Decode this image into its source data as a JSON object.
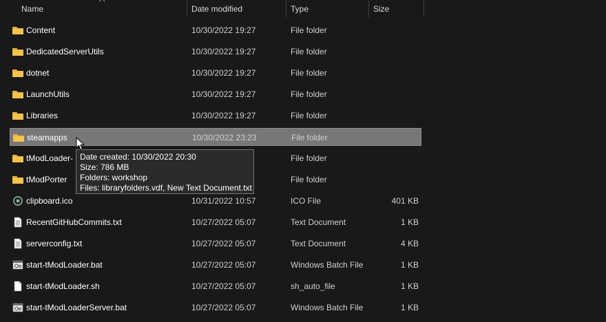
{
  "columns": {
    "name": "Name",
    "date": "Date modified",
    "type": "Type",
    "size": "Size"
  },
  "files": [
    {
      "name": "Content",
      "date": "10/30/2022 19:27",
      "type": "File folder",
      "size": "",
      "icon": "folder-icon"
    },
    {
      "name": "DedicatedServerUtils",
      "date": "10/30/2022 19:27",
      "type": "File folder",
      "size": "",
      "icon": "folder-icon"
    },
    {
      "name": "dotnet",
      "date": "10/30/2022 19:27",
      "type": "File folder",
      "size": "",
      "icon": "folder-icon"
    },
    {
      "name": "LaunchUtils",
      "date": "10/30/2022 19:27",
      "type": "File folder",
      "size": "",
      "icon": "folder-icon"
    },
    {
      "name": "Libraries",
      "date": "10/30/2022 19:27",
      "type": "File folder",
      "size": "",
      "icon": "folder-icon"
    },
    {
      "name": "steamapps",
      "date": "10/30/2022 23:23",
      "type": "File folder",
      "size": "",
      "icon": "folder-icon",
      "selected": true
    },
    {
      "name": "tModLoader-",
      "date": "",
      "type": "File folder",
      "size": "",
      "icon": "folder-icon"
    },
    {
      "name": "tModPorter",
      "date": "",
      "type": "File folder",
      "size": "",
      "icon": "folder-icon"
    },
    {
      "name": "clipboard.ico",
      "date": "10/31/2022 10:57",
      "type": "ICO File",
      "size": "401 KB",
      "icon": "ico-file-icon"
    },
    {
      "name": "RecentGitHubCommits.txt",
      "date": "10/27/2022 05:07",
      "type": "Text Document",
      "size": "1 KB",
      "icon": "text-file-icon"
    },
    {
      "name": "serverconfig.txt",
      "date": "10/27/2022 05:07",
      "type": "Text Document",
      "size": "4 KB",
      "icon": "text-file-icon"
    },
    {
      "name": "start-tModLoader.bat",
      "date": "10/27/2022 05:07",
      "type": "Windows Batch File",
      "size": "1 KB",
      "icon": "batch-file-icon"
    },
    {
      "name": "start-tModLoader.sh",
      "date": "10/27/2022 05:07",
      "type": "sh_auto_file",
      "size": "1 KB",
      "icon": "blank-file-icon"
    },
    {
      "name": "start-tModLoaderServer.bat",
      "date": "10/27/2022 05:07",
      "type": "Windows Batch File",
      "size": "1 KB",
      "icon": "batch-file-icon"
    }
  ],
  "tooltip": {
    "created": "Date created: 10/30/2022 20:30",
    "size": "Size: 786 MB",
    "folders": "Folders: workshop",
    "files": "Files: libraryfolders.vdf, New Text Document.txt"
  },
  "colors": {
    "background": "#191919",
    "selection": "#777777",
    "folder": "#f4c44c"
  }
}
